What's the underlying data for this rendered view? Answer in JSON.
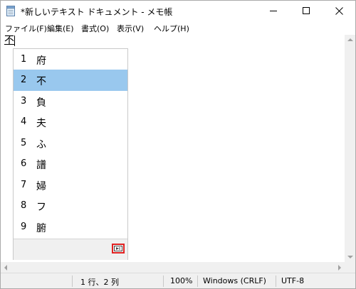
{
  "window": {
    "title": "*新しいテキスト ドキュメント - メモ帳"
  },
  "menu": [
    "ファイル(F)",
    "編集(E)",
    "書式(O)",
    "表示(V)",
    "ヘルプ(H)"
  ],
  "editor": {
    "composing_text": "不"
  },
  "ime": {
    "selected_index": 1,
    "candidates": [
      {
        "num": "1",
        "char": "府"
      },
      {
        "num": "2",
        "char": "不"
      },
      {
        "num": "3",
        "char": "負"
      },
      {
        "num": "4",
        "char": "夫"
      },
      {
        "num": "5",
        "char": "ふ"
      },
      {
        "num": "6",
        "char": "譜"
      },
      {
        "num": "7",
        "char": "婦"
      },
      {
        "num": "8",
        "char": "フ"
      },
      {
        "num": "9",
        "char": "腑"
      }
    ],
    "expand_icon": "expand-candidates-icon"
  },
  "status": {
    "position": "1 行、2 列",
    "zoom": "100%",
    "line_ending": "Windows (CRLF)",
    "encoding": "UTF-8"
  },
  "colors": {
    "selected_candidate": "#99c8ee",
    "highlight_box": "#e02020",
    "chrome": "#f0f0f0"
  }
}
